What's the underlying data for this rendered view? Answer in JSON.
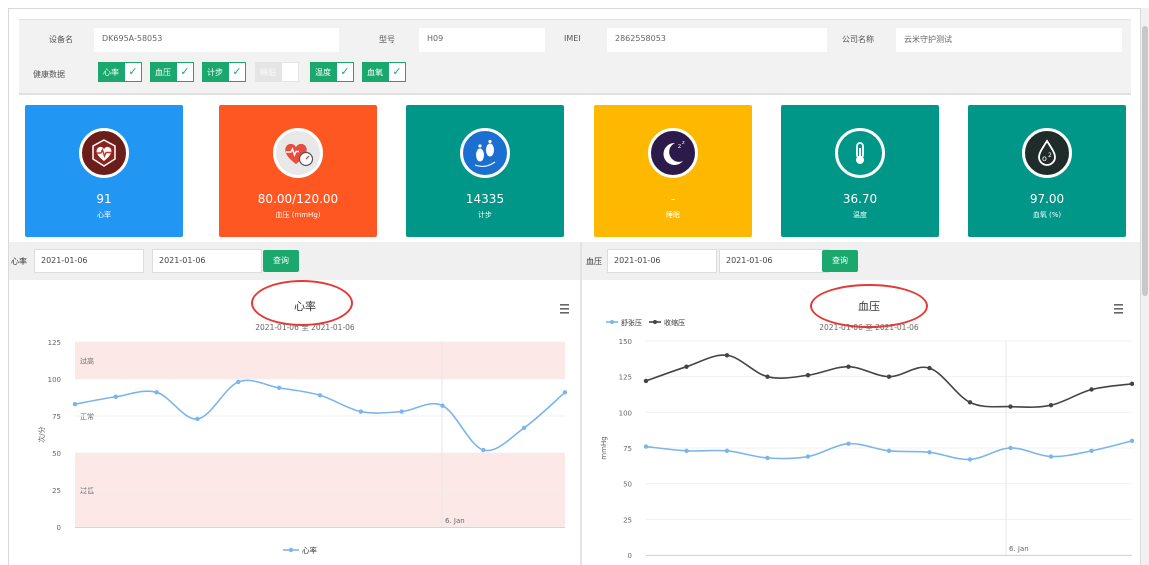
{
  "device": {
    "name_label": "设备名",
    "name_value": "DK695A-58053",
    "model_label": "型号",
    "model_value": "H09",
    "imei_label": "IMEI",
    "imei_value": "2862558053",
    "company_label": "公司名称",
    "company_value": "云米守护测试",
    "health_label": "健康数据",
    "health_items": [
      {
        "label": "心率",
        "checked": true
      },
      {
        "label": "血压",
        "checked": true
      },
      {
        "label": "计步",
        "checked": true
      },
      {
        "label": "睡眠",
        "checked": false
      },
      {
        "label": "温度",
        "checked": true
      },
      {
        "label": "血氧",
        "checked": true
      }
    ]
  },
  "cards": [
    {
      "value": "91",
      "name": "心率",
      "color": "#2196f3",
      "icon": "heart-pulse-icon"
    },
    {
      "value": "80.00/120.00",
      "name": "血压 (mmHg)",
      "color": "#ff5722",
      "icon": "blood-pressure-gauge-icon"
    },
    {
      "value": "14335",
      "name": "计步",
      "color": "#009688",
      "icon": "footsteps-icon"
    },
    {
      "value": "-",
      "name": "睡眠",
      "color": "#ffb800",
      "icon": "moon-sleep-icon"
    },
    {
      "value": "36.70",
      "name": "温度",
      "color": "#009688",
      "icon": "thermometer-icon"
    },
    {
      "value": "97.00",
      "name": "血氧 (%)",
      "color": "#009688",
      "icon": "oxygen-drop-icon"
    }
  ],
  "queries": {
    "heart": {
      "label": "心率",
      "start": "2021-01-06",
      "end": "2021-01-06",
      "button": "查询"
    },
    "bp": {
      "label": "血压",
      "start": "2021-01-06",
      "end": "2021-01-06",
      "button": "查询"
    }
  },
  "chart_data": [
    {
      "type": "line",
      "title": "心率",
      "subtitle": "2021-01-06 至 2021-01-06",
      "ylabel": "次/分",
      "ylim": [
        0,
        125
      ],
      "yticks": [
        0,
        25,
        50,
        75,
        100,
        125
      ],
      "x_marker_label": "6. Jan",
      "bands": [
        {
          "label": "过高",
          "from": 100,
          "to": 125,
          "color": "#fde8e8"
        },
        {
          "label": "正常",
          "from": 50,
          "to": 100,
          "color": "#ffffff"
        },
        {
          "label": "过低",
          "from": 0,
          "to": 50,
          "color": "#fde8e8"
        }
      ],
      "legend": "bottom",
      "series": [
        {
          "name": "心率",
          "color": "#7cb5ec",
          "values": [
            83,
            88,
            91,
            73,
            98,
            94,
            89,
            78,
            78,
            82,
            52,
            67,
            91
          ]
        }
      ]
    },
    {
      "type": "line",
      "title": "血压",
      "subtitle": "2021-01-06 至 2021-01-06",
      "ylabel": "mmHg",
      "ylim": [
        0,
        150
      ],
      "yticks": [
        0,
        25,
        50,
        75,
        100,
        125,
        150
      ],
      "x_marker_label": "6. Jan",
      "legend": "top-left",
      "series": [
        {
          "name": "舒张压",
          "color": "#7cb5ec",
          "values": [
            76,
            73,
            73,
            68,
            69,
            78,
            73,
            72,
            67,
            75,
            69,
            73,
            80
          ]
        },
        {
          "name": "收缩压",
          "color": "#434348",
          "values": [
            122,
            132,
            140,
            125,
            126,
            132,
            125,
            131,
            107,
            104,
            105,
            116,
            120
          ]
        }
      ]
    }
  ],
  "menu_icon": "hamburger-menu-icon"
}
